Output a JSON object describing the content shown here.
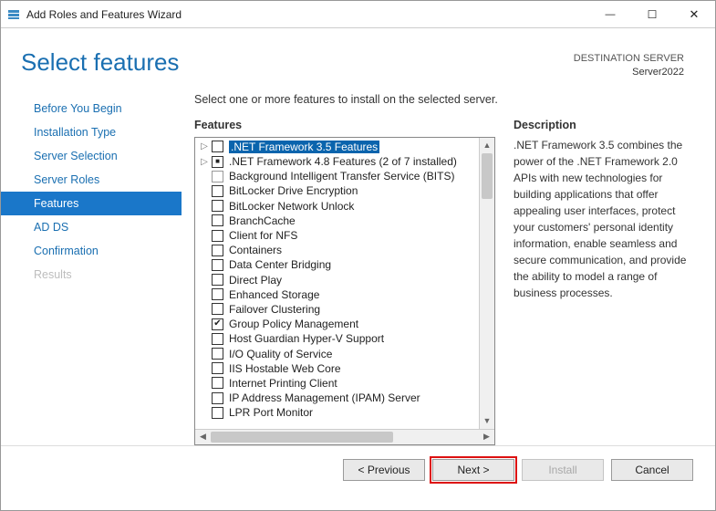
{
  "window": {
    "title": "Add Roles and Features Wizard"
  },
  "header": {
    "title": "Select features",
    "dest_label": "DESTINATION SERVER",
    "dest_name": "Server2022"
  },
  "steps": [
    {
      "label": "Before You Begin",
      "state": "normal"
    },
    {
      "label": "Installation Type",
      "state": "normal"
    },
    {
      "label": "Server Selection",
      "state": "normal"
    },
    {
      "label": "Server Roles",
      "state": "normal"
    },
    {
      "label": "Features",
      "state": "active"
    },
    {
      "label": "AD DS",
      "state": "normal"
    },
    {
      "label": "Confirmation",
      "state": "normal"
    },
    {
      "label": "Results",
      "state": "disabled"
    }
  ],
  "instruction": "Select one or more features to install on the selected server.",
  "features_label": "Features",
  "description_label": "Description",
  "features": [
    {
      "expandable": true,
      "check": "none",
      "label": ".NET Framework 3.5 Features",
      "selected": true
    },
    {
      "expandable": true,
      "check": "partial",
      "label": ".NET Framework 4.8 Features (2 of 7 installed)"
    },
    {
      "expandable": false,
      "check": "grey",
      "label": "Background Intelligent Transfer Service (BITS)"
    },
    {
      "expandable": false,
      "check": "none",
      "label": "BitLocker Drive Encryption"
    },
    {
      "expandable": false,
      "check": "none",
      "label": "BitLocker Network Unlock"
    },
    {
      "expandable": false,
      "check": "none",
      "label": "BranchCache"
    },
    {
      "expandable": false,
      "check": "none",
      "label": "Client for NFS"
    },
    {
      "expandable": false,
      "check": "none",
      "label": "Containers"
    },
    {
      "expandable": false,
      "check": "none",
      "label": "Data Center Bridging"
    },
    {
      "expandable": false,
      "check": "none",
      "label": "Direct Play"
    },
    {
      "expandable": false,
      "check": "none",
      "label": "Enhanced Storage"
    },
    {
      "expandable": false,
      "check": "none",
      "label": "Failover Clustering"
    },
    {
      "expandable": false,
      "check": "checked",
      "label": "Group Policy Management"
    },
    {
      "expandable": false,
      "check": "none",
      "label": "Host Guardian Hyper-V Support"
    },
    {
      "expandable": false,
      "check": "none",
      "label": "I/O Quality of Service"
    },
    {
      "expandable": false,
      "check": "none",
      "label": "IIS Hostable Web Core"
    },
    {
      "expandable": false,
      "check": "none",
      "label": "Internet Printing Client"
    },
    {
      "expandable": false,
      "check": "none",
      "label": "IP Address Management (IPAM) Server"
    },
    {
      "expandable": false,
      "check": "none",
      "label": "LPR Port Monitor"
    }
  ],
  "description": ".NET Framework 3.5 combines the power of the .NET Framework 2.0 APIs with new technologies for building applications that offer appealing user interfaces, protect your customers' personal identity information, enable seamless and secure communication, and provide the ability to model a range of business processes.",
  "buttons": {
    "previous": "< Previous",
    "next": "Next >",
    "install": "Install",
    "cancel": "Cancel"
  }
}
